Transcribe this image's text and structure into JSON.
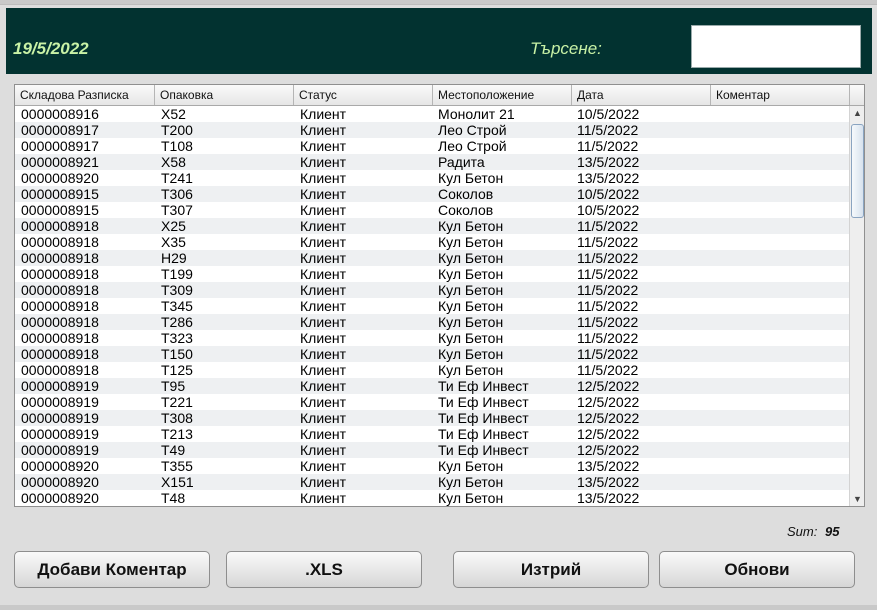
{
  "header": {
    "date": "19/5/2022",
    "search_label": "Търсене:",
    "search_value": ""
  },
  "table": {
    "columns": [
      "Складова Разписка",
      "Опаковка",
      "Статус",
      "Местоположение",
      "Дата",
      "Коментар"
    ],
    "rows": [
      [
        "0000008916",
        "X52",
        "Клиент",
        "Монолит 21",
        "10/5/2022",
        ""
      ],
      [
        "0000008917",
        "T200",
        "Клиент",
        "Лео Строй",
        "11/5/2022",
        ""
      ],
      [
        "0000008917",
        "T108",
        "Клиент",
        "Лео Строй",
        "11/5/2022",
        ""
      ],
      [
        "0000008921",
        "X58",
        "Клиент",
        "Радита",
        "13/5/2022",
        ""
      ],
      [
        "0000008920",
        "T241",
        "Клиент",
        "Кул Бетон",
        "13/5/2022",
        ""
      ],
      [
        "0000008915",
        "T306",
        "Клиент",
        "Соколов",
        "10/5/2022",
        ""
      ],
      [
        "0000008915",
        "T307",
        "Клиент",
        "Соколов",
        "10/5/2022",
        ""
      ],
      [
        "0000008918",
        "X25",
        "Клиент",
        "Кул Бетон",
        "11/5/2022",
        ""
      ],
      [
        "0000008918",
        "X35",
        "Клиент",
        "Кул Бетон",
        "11/5/2022",
        ""
      ],
      [
        "0000008918",
        "H29",
        "Клиент",
        "Кул Бетон",
        "11/5/2022",
        ""
      ],
      [
        "0000008918",
        "T199",
        "Клиент",
        "Кул Бетон",
        "11/5/2022",
        ""
      ],
      [
        "0000008918",
        "T309",
        "Клиент",
        "Кул Бетон",
        "11/5/2022",
        ""
      ],
      [
        "0000008918",
        "T345",
        "Клиент",
        "Кул Бетон",
        "11/5/2022",
        ""
      ],
      [
        "0000008918",
        "T286",
        "Клиент",
        "Кул Бетон",
        "11/5/2022",
        ""
      ],
      [
        "0000008918",
        "T323",
        "Клиент",
        "Кул Бетон",
        "11/5/2022",
        ""
      ],
      [
        "0000008918",
        "T150",
        "Клиент",
        "Кул Бетон",
        "11/5/2022",
        ""
      ],
      [
        "0000008918",
        "T125",
        "Клиент",
        "Кул Бетон",
        "11/5/2022",
        ""
      ],
      [
        "0000008919",
        "T95",
        "Клиент",
        "Ти Еф Инвест",
        "12/5/2022",
        ""
      ],
      [
        "0000008919",
        "T221",
        "Клиент",
        "Ти Еф Инвест",
        "12/5/2022",
        ""
      ],
      [
        "0000008919",
        "T308",
        "Клиент",
        "Ти Еф Инвест",
        "12/5/2022",
        ""
      ],
      [
        "0000008919",
        "T213",
        "Клиент",
        "Ти Еф Инвест",
        "12/5/2022",
        ""
      ],
      [
        "0000008919",
        "T49",
        "Клиент",
        "Ти Еф Инвест",
        "12/5/2022",
        ""
      ],
      [
        "0000008920",
        "T355",
        "Клиент",
        "Кул Бетон",
        "13/5/2022",
        ""
      ],
      [
        "0000008920",
        "X151",
        "Клиент",
        "Кул Бетон",
        "13/5/2022",
        ""
      ],
      [
        "0000008920",
        "T48",
        "Клиент",
        "Кул Бетон",
        "13/5/2022",
        ""
      ]
    ]
  },
  "scrollbar": {
    "up_icon": "arrow-up-icon",
    "down_icon": "arrow-down-icon"
  },
  "summary": {
    "label": "Sum:",
    "value": "95"
  },
  "buttons": {
    "add_comment": "Добави Коментар",
    "export_xls": ".XLS",
    "delete": "Изтрий",
    "refresh": "Обнови"
  },
  "colors": {
    "header_bg": "#023230",
    "header_text": "#c9f2a6"
  }
}
